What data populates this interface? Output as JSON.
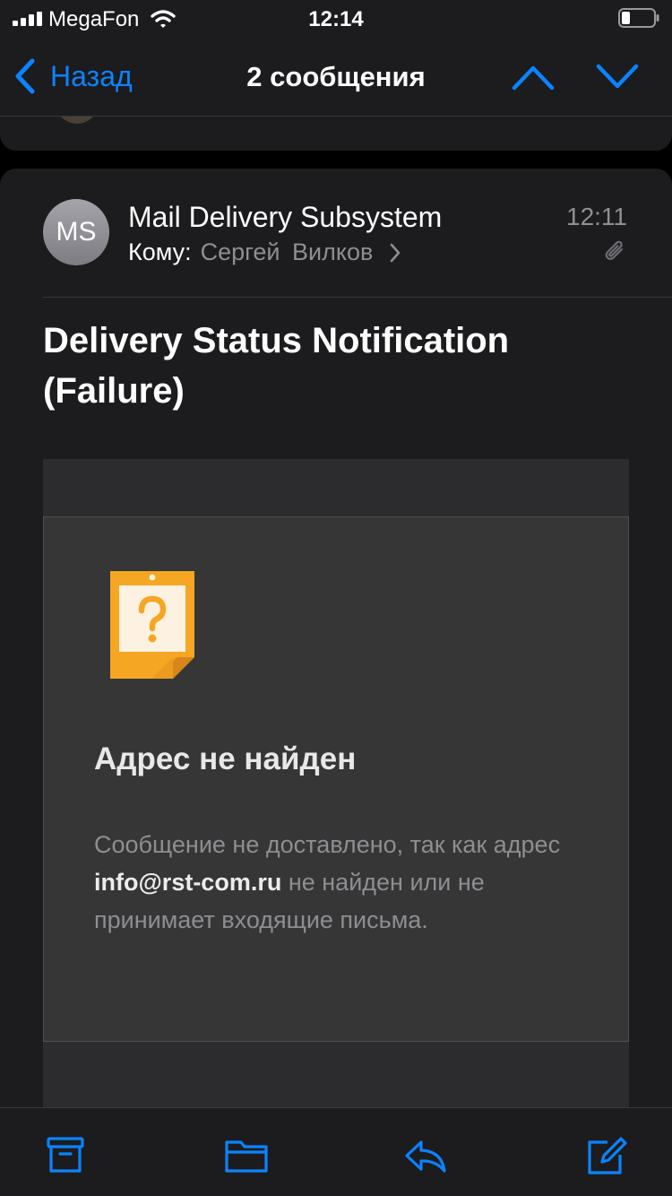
{
  "status_bar": {
    "carrier": "MegaFon",
    "time": "12:14",
    "icons": [
      "signal-icon",
      "wifi-icon",
      "battery-icon"
    ]
  },
  "nav": {
    "back_label": "Назад",
    "title": "2 сообщения",
    "icons": [
      "chevron-left-icon",
      "chevron-up-icon",
      "chevron-down-icon"
    ]
  },
  "message": {
    "avatar_initials": "MS",
    "sender": "Mail Delivery Subsystem",
    "time": "12:11",
    "to_label": "Кому:",
    "to_value": "Сергей Вилков",
    "subject": "Delivery Status Notification (Failure)",
    "icons": [
      "chevron-right-icon",
      "paperclip-icon"
    ]
  },
  "mail_body": {
    "icon": "question-note-icon",
    "heading": "Адрес не найден",
    "text_before": "Сообщение не доставлено, так как адрес ",
    "address": "info@rst-com.ru",
    "text_after": " не найден или не принимает входящие письма."
  },
  "toolbar": {
    "icons": [
      "archive-icon",
      "folder-icon",
      "reply-icon",
      "compose-icon"
    ]
  },
  "colors": {
    "accent": "#0a84ff",
    "background": "#1c1c1e",
    "secondary_text": "#8e8e93",
    "note_orange": "#f5a623"
  }
}
